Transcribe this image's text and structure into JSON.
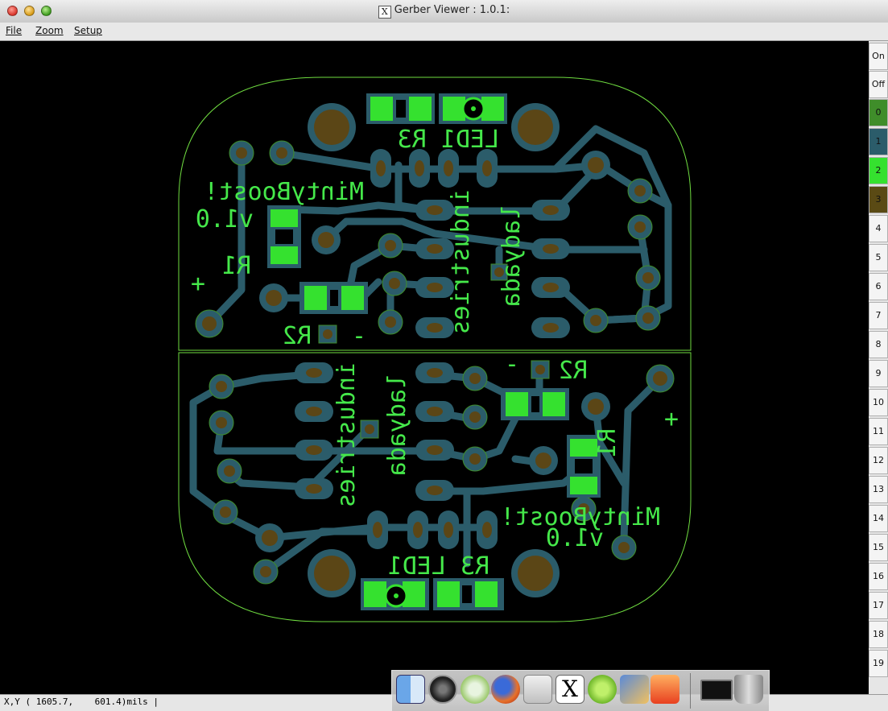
{
  "window": {
    "title": "Gerber Viewer : 1.0.1:"
  },
  "menu": [
    {
      "label": "File"
    },
    {
      "label": "Zoom"
    },
    {
      "label": "Setup"
    }
  ],
  "pcb": {
    "labels": {
      "top": [
        "LED1 R3",
        "MintyBoost!",
        "v1.0",
        "R1",
        "+",
        "R2",
        "-",
        "ladyada",
        "industries"
      ],
      "bottom": [
        "R2",
        "-",
        "+",
        "R1",
        "MintyBoost!",
        "v1.0",
        "R3 LED1",
        "ladyada",
        "industries"
      ]
    },
    "colors": {
      "outline": "#6fdc40",
      "trace": "#2b5c6a",
      "pad": "#6f5a1c",
      "silk": "#45e84a",
      "pad_fill": "#5b4616"
    }
  },
  "layers": {
    "on_label": "On",
    "off_label": "Off",
    "items": [
      {
        "label": "0",
        "color": "#3f8d2a"
      },
      {
        "label": "1",
        "color": "#2b5c6a"
      },
      {
        "label": "2",
        "color": "#35e12f"
      },
      {
        "label": "3",
        "color": "#5a4a14"
      },
      {
        "label": "4",
        "color": ""
      },
      {
        "label": "5",
        "color": ""
      },
      {
        "label": "6",
        "color": ""
      },
      {
        "label": "7",
        "color": ""
      },
      {
        "label": "8",
        "color": ""
      },
      {
        "label": "9",
        "color": ""
      },
      {
        "label": "10",
        "color": ""
      },
      {
        "label": "11",
        "color": ""
      },
      {
        "label": "12",
        "color": ""
      },
      {
        "label": "13",
        "color": ""
      },
      {
        "label": "14",
        "color": ""
      },
      {
        "label": "15",
        "color": ""
      },
      {
        "label": "16",
        "color": ""
      },
      {
        "label": "17",
        "color": ""
      },
      {
        "label": "18",
        "color": ""
      },
      {
        "label": "19",
        "color": ""
      }
    ]
  },
  "status": {
    "coords": "X,Y ( 1605.7,    601.4)mils |"
  },
  "dock": {
    "items": [
      {
        "icon": "finder-icon"
      },
      {
        "icon": "dashboard-icon"
      },
      {
        "icon": "itunes-icon"
      },
      {
        "icon": "firefox-icon"
      },
      {
        "icon": "mail-icon"
      },
      {
        "icon": "x11-icon"
      },
      {
        "icon": "dreamweaver-icon"
      },
      {
        "icon": "iphoto-icon"
      },
      {
        "icon": "vlc-icon"
      },
      {
        "icon": "terminal-icon"
      },
      {
        "icon": "trash-icon"
      }
    ]
  }
}
